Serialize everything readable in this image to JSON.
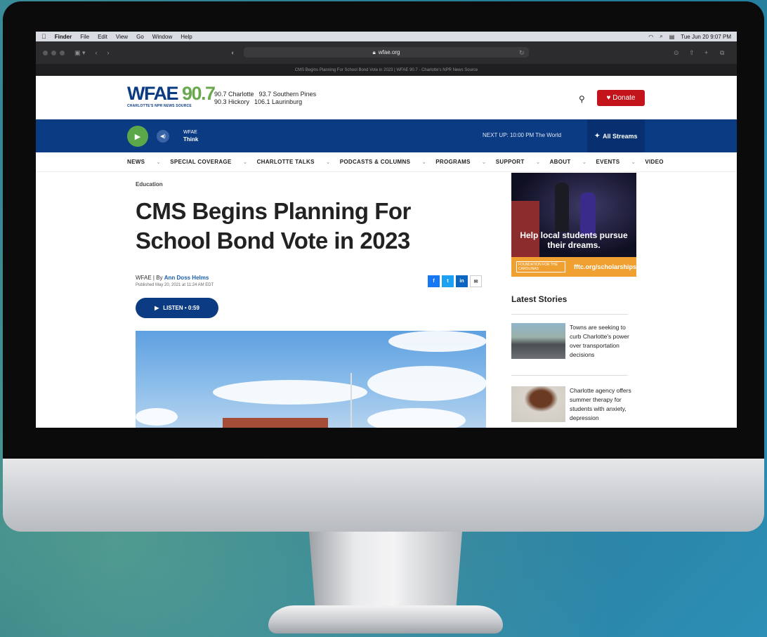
{
  "mac": {
    "menus": [
      "Finder",
      "File",
      "Edit",
      "View",
      "Go",
      "Window",
      "Help"
    ],
    "clock": "Tue Jun 20  9:07 PM"
  },
  "browser": {
    "url": "wfae.org",
    "tab_title": "CMS Begins Planning For School Bond Vote in 2023 | WFAE 90.7 - Charlotte's NPR News Source"
  },
  "site": {
    "logo_word": "WFAE",
    "logo_num": "90.7",
    "logo_tag": "CHARLOTTE'S NPR NEWS SOURCE",
    "freq1a": "90.7 Charlotte",
    "freq1b": "93.7 Southern Pines",
    "freq2a": "90.3 Hickory",
    "freq2b": "106.1 Laurinburg",
    "donate": "♥ Donate"
  },
  "player": {
    "station": "WFAE",
    "program": "Think",
    "next_up": "NEXT UP: 10:00 PM The World",
    "streams": "All Streams"
  },
  "nav": [
    "NEWS",
    "SPECIAL COVERAGE",
    "CHARLOTTE TALKS",
    "PODCASTS & COLUMNS",
    "PROGRAMS",
    "SUPPORT",
    "ABOUT",
    "EVENTS",
    "VIDEO"
  ],
  "article": {
    "category": "Education",
    "title": "CMS Begins Planning For School Bond Vote in 2023",
    "byline_prefix": "WFAE | By ",
    "author": "Ann Doss Helms",
    "published": "Published May 20, 2021 at 11:24 AM EDT",
    "listen": "LISTEN  •  0:59"
  },
  "ad": {
    "headline": "Help local students pursue their dreams.",
    "logo": "FOUNDATION FOR THE CAROLINAS",
    "link": "fftc.org/scholarships"
  },
  "sidebar": {
    "heading": "Latest Stories",
    "stories": [
      "Towns are seeking to curb Charlotte's power over transportation decisions",
      "Charlotte agency offers summer therapy for students with anxiety, depression"
    ]
  }
}
